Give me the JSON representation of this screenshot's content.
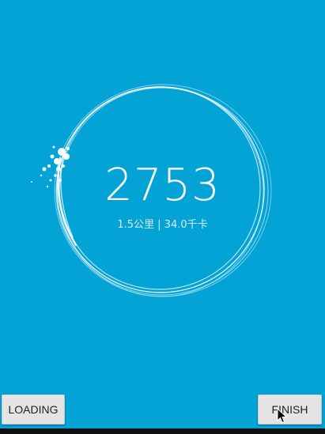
{
  "progress": {
    "steps": "2753",
    "distance_calories": "1.5公里 | 34.0千卡"
  },
  "buttons": {
    "loading_label": "LOADING",
    "finish_label": "FINISH"
  },
  "colors": {
    "background": "#03a3d6",
    "ring": "#ffffff"
  }
}
